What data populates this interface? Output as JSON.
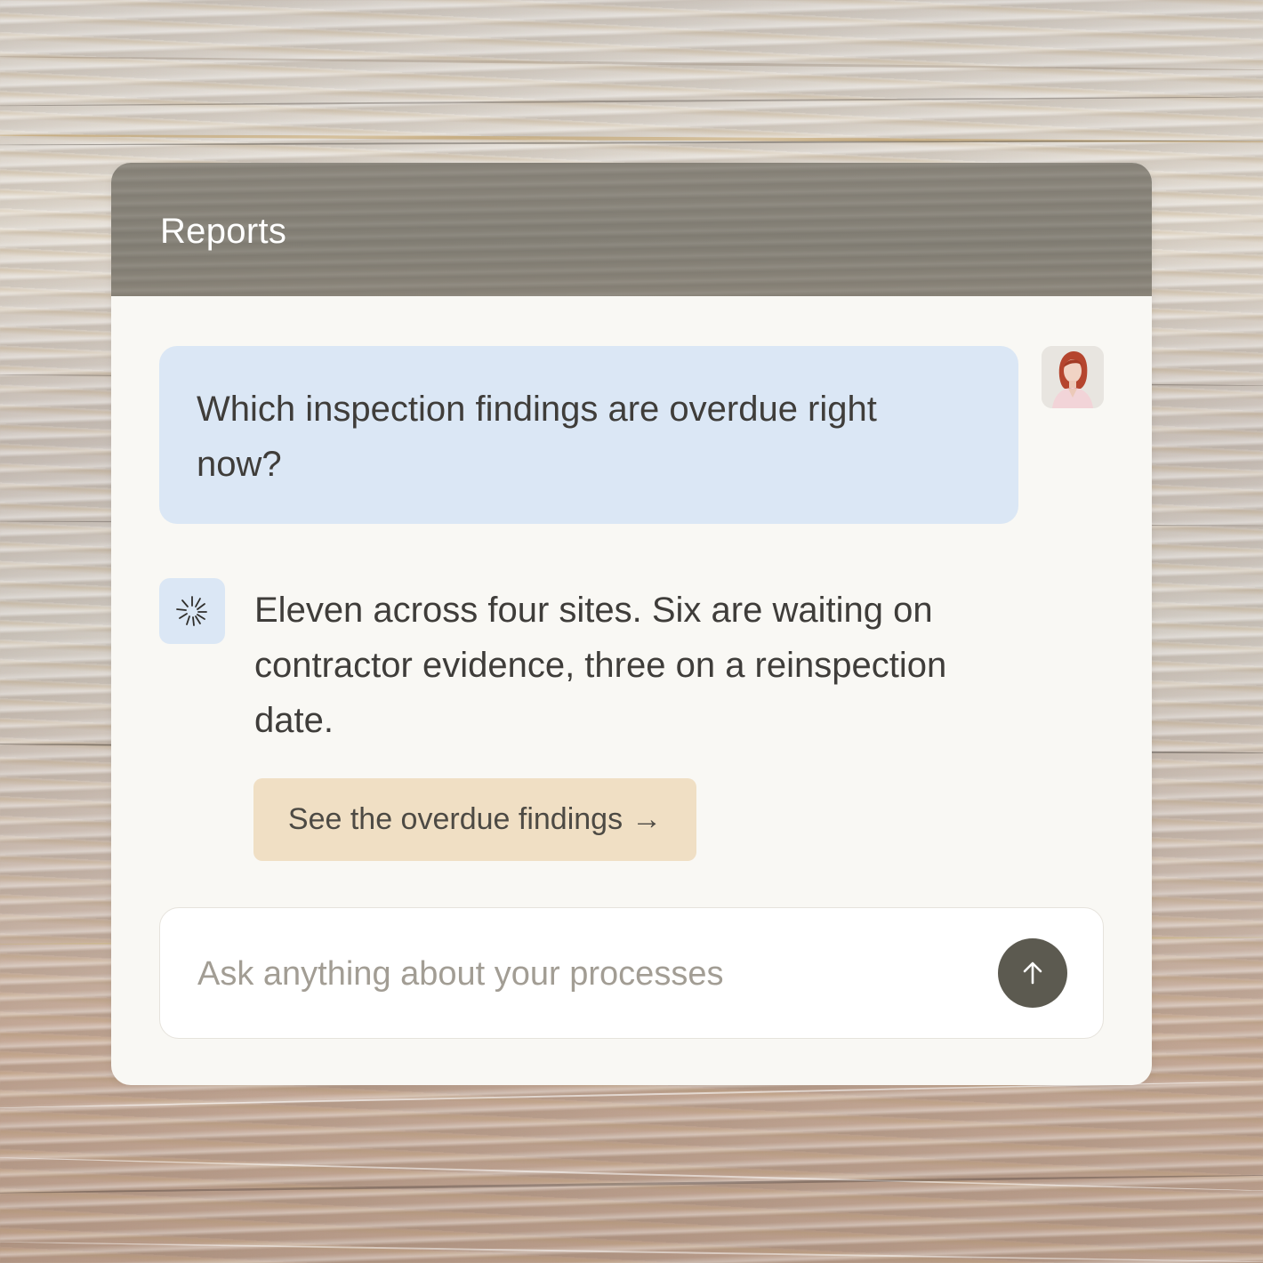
{
  "header": {
    "title": "Reports"
  },
  "messages": {
    "user": {
      "text": "Which inspection findings are overdue right now?"
    },
    "assistant": {
      "text": "Eleven across four sites. Six are waiting on contractor evidence, three on a reinspection date.",
      "action_label": "See the overdue findings",
      "action_arrow": "→"
    }
  },
  "composer": {
    "placeholder": "Ask anything about your processes",
    "value": ""
  },
  "icons": {
    "user_avatar": "user-avatar",
    "assistant": "sparkle-burst-icon",
    "send": "arrow-up-icon"
  },
  "colors": {
    "header": "#858076",
    "panel": "#f9f8f4",
    "user_bubble": "#dbe7f5",
    "action_button": "#f0dfc4",
    "send_button": "#5c5a50"
  }
}
